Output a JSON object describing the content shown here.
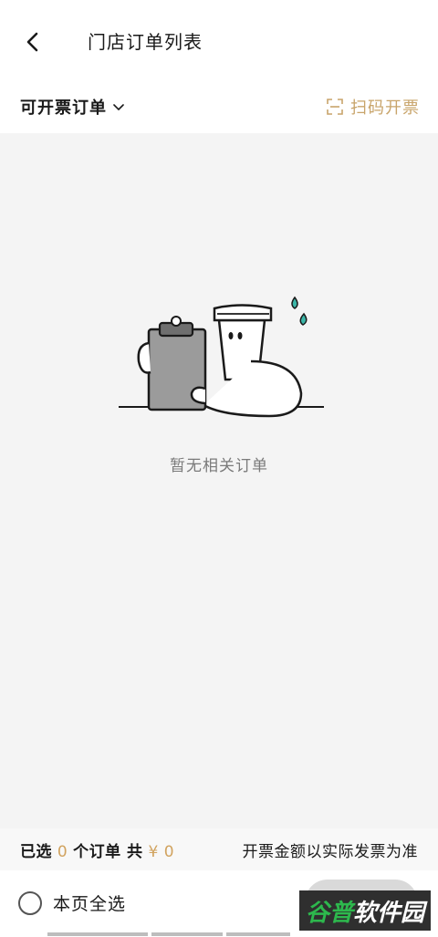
{
  "header": {
    "title": "门店订单列表",
    "back_icon": "chevron-left-icon"
  },
  "filter": {
    "dropdown_label": "可开票订单",
    "dropdown_icon": "chevron-down-icon",
    "scan_label": "扫码开票",
    "scan_icon": "scan-icon"
  },
  "empty_state": {
    "message": "暂无相关订单",
    "illustration": "coffee-cup-clipboard-illustration"
  },
  "summary": {
    "selected_prefix": "已选",
    "selected_count": "0",
    "orders_label": "个订单 共",
    "currency": "¥",
    "total_amount": "0",
    "note": "开票金额以实际发票为准"
  },
  "footer": {
    "select_all_label": "本页全选"
  },
  "watermark": {
    "part1": "谷普",
    "part2": "软件园"
  },
  "colors": {
    "accent": "#c8a46a",
    "amount": "#d1a35f",
    "background": "#f4f4f4",
    "cup_drop": "#3bb6a8"
  }
}
